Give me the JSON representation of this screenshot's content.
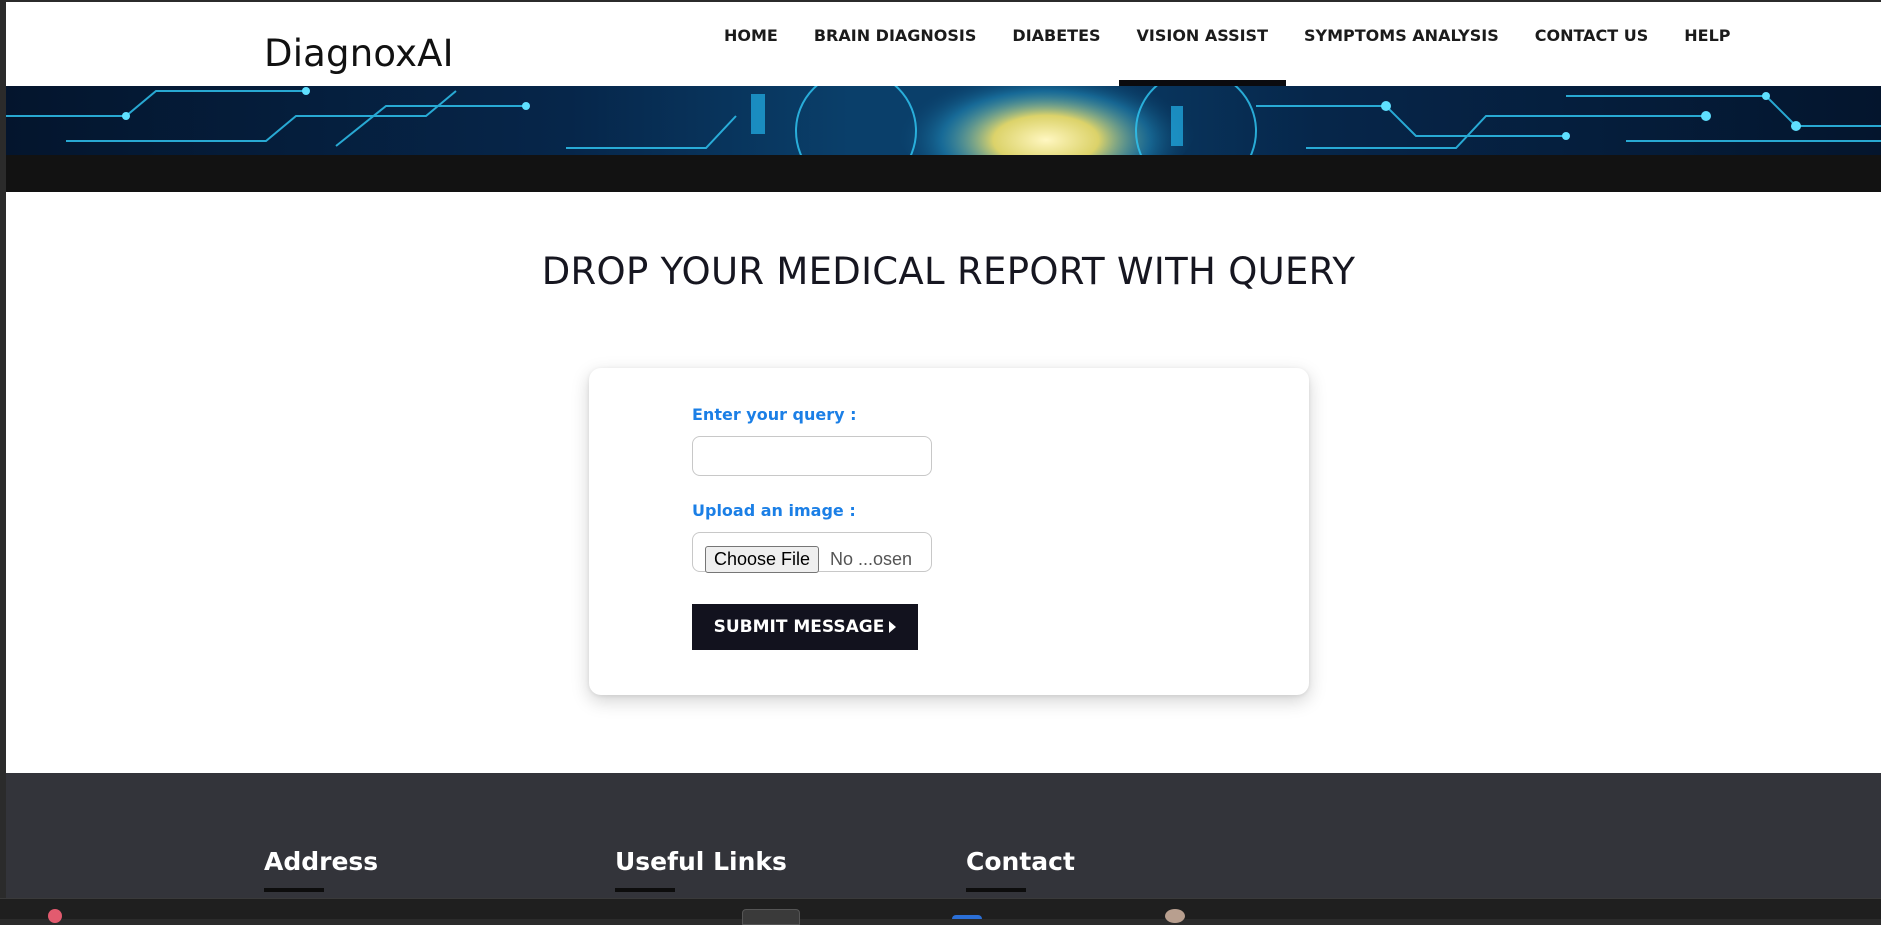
{
  "header": {
    "brand": "DiagnoxAI",
    "nav": [
      {
        "label": "HOME",
        "active": false
      },
      {
        "label": "BRAIN DIAGNOSIS",
        "active": false
      },
      {
        "label": "DIABETES",
        "active": false
      },
      {
        "label": "VISION ASSIST",
        "active": true
      },
      {
        "label": "SYMPTOMS ANALYSIS",
        "active": false
      },
      {
        "label": "CONTACT US",
        "active": false
      },
      {
        "label": "HELP",
        "active": false
      }
    ]
  },
  "main": {
    "title": "DROP YOUR MEDICAL REPORT WITH QUERY",
    "form": {
      "query_label": "Enter your query :",
      "query_value": "",
      "upload_label": "Upload an image :",
      "file_button_label": "Choose File",
      "file_status": "No ...osen",
      "submit_label": "SUBMIT MESSAGE"
    }
  },
  "footer": {
    "columns": [
      {
        "heading": "Address"
      },
      {
        "heading": "Useful Links"
      },
      {
        "heading": "Contact"
      }
    ]
  },
  "colors": {
    "accent_label": "#1b7fe6",
    "button_dark": "#12121e",
    "footer_bg": "#33343a"
  },
  "icons": {
    "submit": "caret-right-icon"
  }
}
